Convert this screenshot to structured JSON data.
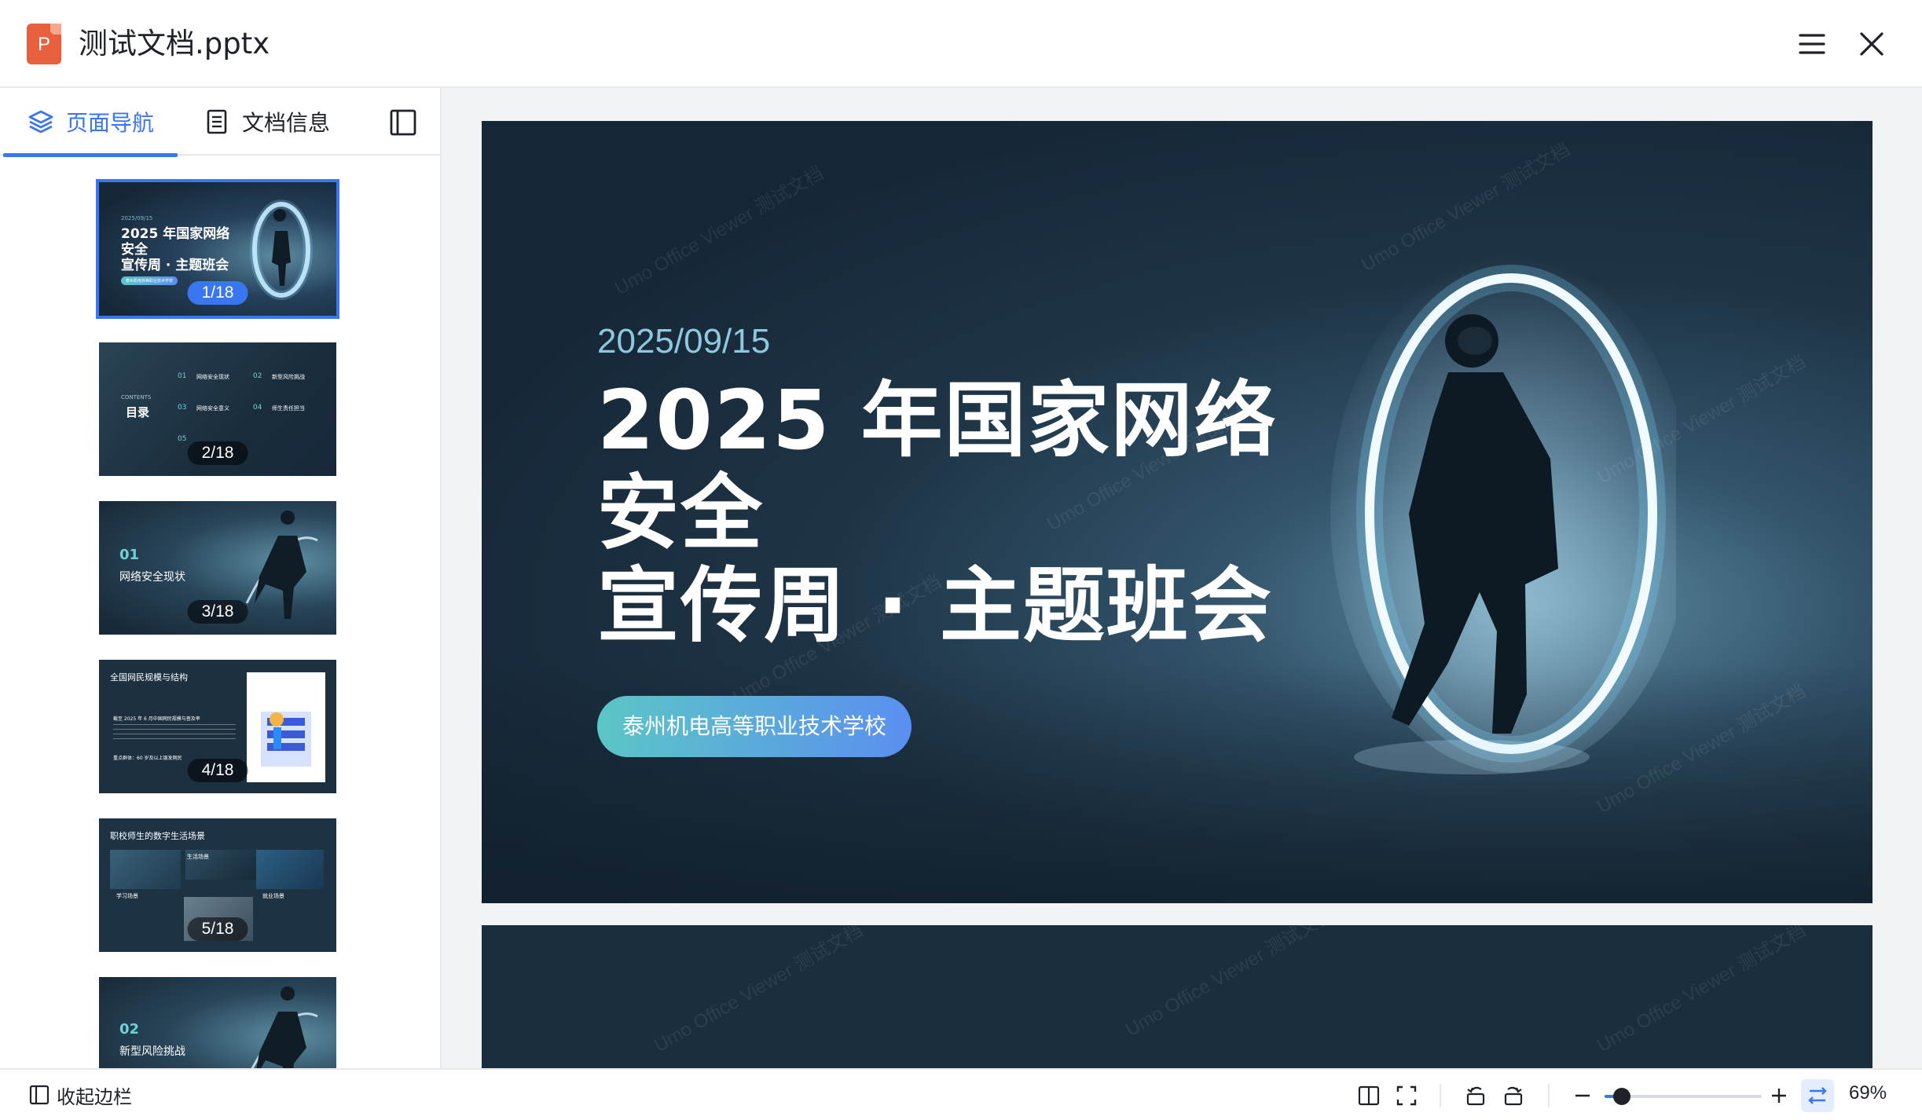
{
  "app": {
    "file_type_letter": "P",
    "document_title": "测试文档.pptx"
  },
  "sidebar": {
    "tabs": [
      {
        "label": "页面导航",
        "icon": "layers-icon",
        "active": true
      },
      {
        "label": "文档信息",
        "icon": "document-list-icon",
        "active": false
      }
    ],
    "thumbnails": [
      {
        "page": "1/18",
        "date": "2025/09/15",
        "title_lines": [
          "2025 年国家网络",
          "安全",
          "宣传周 · 主题班会"
        ],
        "subtitle": "泰州机电高等职业技术学校",
        "active": true
      },
      {
        "page": "2/18",
        "contents_label": "CONTENTS",
        "heading": "目录",
        "items": [
          {
            "num": "01",
            "text": "网络安全现状"
          },
          {
            "num": "02",
            "text": "新型风险挑战"
          },
          {
            "num": "03",
            "text": "网络安全意义"
          },
          {
            "num": "04",
            "text": "师生责任担当"
          },
          {
            "num": "05",
            "text": ""
          }
        ]
      },
      {
        "page": "3/18",
        "num": "01",
        "heading": "网络安全现状"
      },
      {
        "page": "4/18",
        "heading": "全国网民规模与结构",
        "body1": "截至 2025 年 6 月中国网民规模与普及率",
        "body2": "重点群体：60 岁及以上银发网民"
      },
      {
        "page": "5/18",
        "heading": "职校师生的数字生活场景",
        "labels": [
          "生活场景",
          "学习场景",
          "就业场景"
        ]
      },
      {
        "page": "6/18",
        "num": "02",
        "heading": "新型风险挑战"
      }
    ]
  },
  "slide": {
    "date": "2025/09/15",
    "title_lines": [
      "2025 年国家网络",
      "安全",
      "宣传周 · 主题班会"
    ],
    "school": "泰州机电高等职业技术学校",
    "watermark": "Umo Office Viewer 测试文档"
  },
  "statusbar": {
    "collapse_label": "收起边栏",
    "zoom_label": "69%",
    "zoom_fraction": 0.69
  },
  "colors": {
    "accent": "#3a76f0",
    "file_icon": "#e8613f"
  }
}
